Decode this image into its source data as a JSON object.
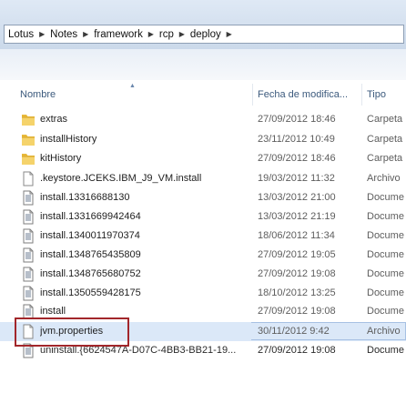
{
  "breadcrumb": {
    "items": [
      "Lotus",
      "Notes",
      "framework",
      "rcp",
      "deploy"
    ]
  },
  "columns": {
    "name": "Nombre",
    "date": "Fecha de modifica...",
    "type": "Tipo"
  },
  "files": [
    {
      "name": "extras",
      "date": "27/09/2012 18:46",
      "type": "Carpeta",
      "icon": "folder-icon"
    },
    {
      "name": "installHistory",
      "date": "23/11/2012 10:49",
      "type": "Carpeta",
      "icon": "folder-icon"
    },
    {
      "name": "kitHistory",
      "date": "27/09/2012 18:46",
      "type": "Carpeta",
      "icon": "folder-icon"
    },
    {
      "name": ".keystore.JCEKS.IBM_J9_VM.install",
      "date": "19/03/2012 11:32",
      "type": "Archivo",
      "icon": "file-icon"
    },
    {
      "name": "install.13316688130",
      "date": "13/03/2012 21:00",
      "type": "Docume",
      "icon": "text-document-icon"
    },
    {
      "name": "install.1331669942464",
      "date": "13/03/2012 21:19",
      "type": "Docume",
      "icon": "text-document-icon"
    },
    {
      "name": "install.1340011970374",
      "date": "18/06/2012 11:34",
      "type": "Docume",
      "icon": "text-document-icon"
    },
    {
      "name": "install.1348765435809",
      "date": "27/09/2012 19:05",
      "type": "Docume",
      "icon": "text-document-icon"
    },
    {
      "name": "install.1348765680752",
      "date": "27/09/2012 19:08",
      "type": "Docume",
      "icon": "text-document-icon"
    },
    {
      "name": "install.1350559428175",
      "date": "18/10/2012 13:25",
      "type": "Docume",
      "icon": "text-document-icon"
    },
    {
      "name": "install",
      "date": "27/09/2012 19:08",
      "type": "Docume",
      "icon": "text-document-icon"
    },
    {
      "name": "jvm.properties",
      "date": "30/11/2012 9:42",
      "type": "Archivo",
      "icon": "file-icon",
      "selected": true
    },
    {
      "name": "uninstall.{6624547A-D07C-4BB3-BB21-19...",
      "date": "27/09/2012 19:08",
      "type": "Docume",
      "icon": "text-document-icon"
    }
  ]
}
